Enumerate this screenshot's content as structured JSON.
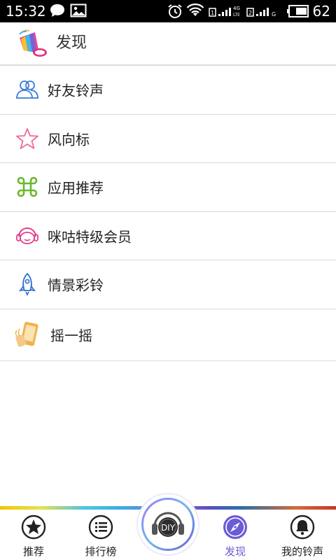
{
  "status_bar": {
    "time": "15:32",
    "battery_percent": "62",
    "icons": [
      "message-icon",
      "image-icon",
      "alarm-icon",
      "wifi-icon",
      "signal-1-icon",
      "signal-2-icon",
      "battery-icon"
    ]
  },
  "header": {
    "title": "发现",
    "logo": "megaphone-logo"
  },
  "menu": {
    "items": [
      {
        "label": "好友铃声",
        "icon": "friends-icon",
        "color": "#3a7bd5"
      },
      {
        "label": "风向标",
        "icon": "star-icon",
        "color": "#f06a9b"
      },
      {
        "label": "应用推荐",
        "icon": "command-icon",
        "color": "#6ab82f"
      },
      {
        "label": "咪咕特级会员",
        "icon": "headset-member-icon",
        "color": "#e0418a"
      },
      {
        "label": "情景彩铃",
        "icon": "rocket-icon",
        "color": "#2d6fd0"
      },
      {
        "label": "摇一摇",
        "icon": "shake-phone-icon",
        "color": "#f0b24a"
      }
    ]
  },
  "bottom_nav": {
    "items": [
      {
        "label": "推荐",
        "icon": "star-circle-icon"
      },
      {
        "label": "排行榜",
        "icon": "list-circle-icon"
      },
      {
        "label": "发现",
        "icon": "compass-icon",
        "active": true
      },
      {
        "label": "我的铃声",
        "icon": "bell-icon"
      }
    ],
    "diy_label": "DIY",
    "active_color": "#6a5bd6"
  }
}
